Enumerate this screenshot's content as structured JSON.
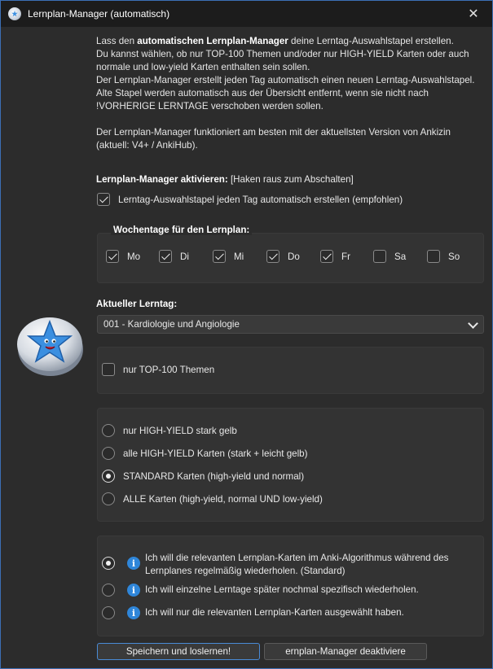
{
  "window": {
    "title": "Lernplan-Manager (automatisch)",
    "close_icon": "close-icon",
    "accent": "#3c6fb5"
  },
  "intro": {
    "line1_pre": "Lass den ",
    "line1_bold": "automatischen Lernplan-Manager",
    "line1_post": " deine Lerntag-Auswahlstapel erstellen.",
    "line2": "Du kannst wählen, ob nur TOP-100 Themen und/oder nur HIGH-YIELD Karten oder auch",
    "line3": "normale und low-yield Karten enthalten sein sollen.",
    "line4": "Der Lernplan-Manager erstellt jeden Tag automatisch einen neuen Lerntag-Auswahlstapel.",
    "line5": "Alte Stapel werden automatisch aus der Übersicht entfernt, wenn sie nicht nach",
    "line6": "!VORHERIGE LERNTAGE verschoben werden sollen.",
    "line7": "Der Lernplan-Manager funktioniert am besten mit der aktuellsten Version von Ankizin",
    "line8": "(aktuell: V4+ / AnkiHub)."
  },
  "activate": {
    "label_bold": "Lernplan-Manager aktivieren:",
    "label_hint": " [Haken raus zum Abschalten]",
    "auto_checkbox_label": "Lerntag-Auswahlstapel jeden Tag automatisch erstellen (empfohlen)",
    "auto_checked": true
  },
  "weekdays": {
    "title": "Wochentage für den Lernplan:",
    "days": [
      {
        "label": "Mo",
        "checked": true
      },
      {
        "label": "Di",
        "checked": true
      },
      {
        "label": "Mi",
        "checked": true
      },
      {
        "label": "Do",
        "checked": true
      },
      {
        "label": "Fr",
        "checked": true
      },
      {
        "label": "Sa",
        "checked": false
      },
      {
        "label": "So",
        "checked": false
      }
    ]
  },
  "lerntag": {
    "label": "Aktueller Lerntag:",
    "selected": "001 - Kardiologie und Angiologie"
  },
  "top100": {
    "label": "nur TOP-100 Themen",
    "checked": false
  },
  "yield": {
    "options": [
      {
        "label": "nur HIGH-YIELD stark gelb",
        "checked": false
      },
      {
        "label": "alle HIGH-YIELD Karten (stark + leicht gelb)",
        "checked": false
      },
      {
        "label": "STANDARD Karten (high-yield und normal)",
        "checked": true
      },
      {
        "label": "ALLE Karten (high-yield, normal UND low-yield)",
        "checked": false
      }
    ]
  },
  "repeat": {
    "options": [
      {
        "label": "Ich will die relevanten Lernplan-Karten im Anki-Algorithmus während des Lernplanes regelmäßig wiederholen. (Standard)",
        "checked": true,
        "icon": "info-icon"
      },
      {
        "label": "Ich will einzelne Lerntage später nochmal spezifisch wiederholen.",
        "checked": false,
        "icon": "info-icon"
      },
      {
        "label": "Ich will nur die relevanten Lernplan-Karten ausgewählt haben.",
        "checked": false,
        "icon": "info-icon"
      }
    ]
  },
  "buttons": {
    "save": "Speichern und loslernen!",
    "deactivate": "ernplan-Manager deaktiviere"
  },
  "mascot": "star-mascot-icon"
}
